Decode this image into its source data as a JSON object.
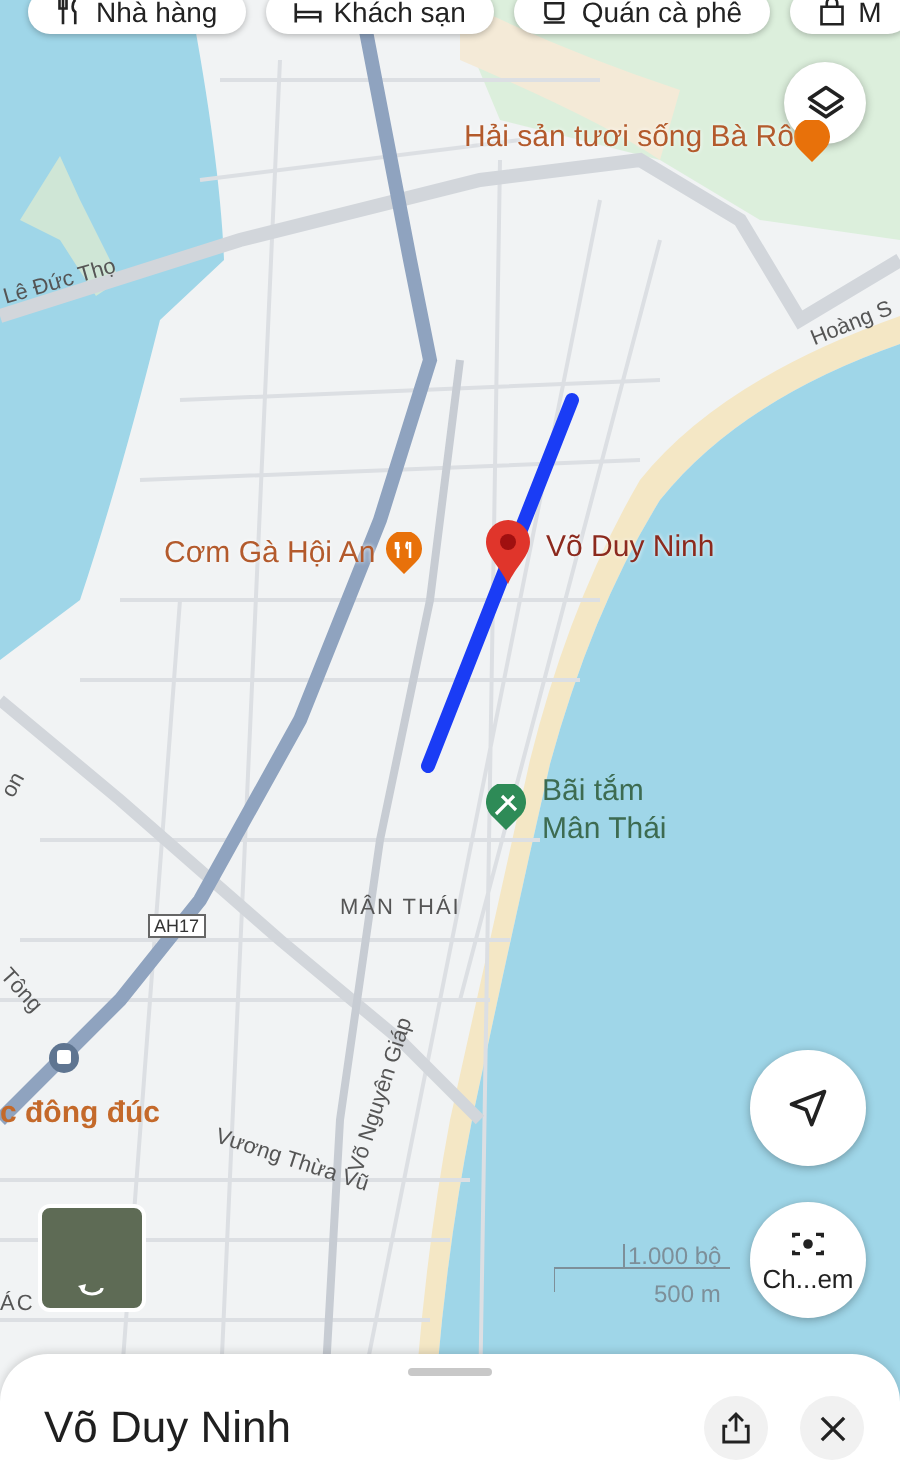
{
  "filter_chips": [
    {
      "label": "Nhà hàng",
      "kind": "restaurant"
    },
    {
      "label": "Khách sạn",
      "kind": "hotel"
    },
    {
      "label": "Quán cà phê",
      "kind": "cafe"
    },
    {
      "label": "M",
      "kind": "shopping"
    }
  ],
  "map_labels": [
    {
      "text": "Hải sản tươi sống Bà Rô",
      "kind": "food"
    },
    {
      "text": "Lê Đức Thọ",
      "kind": "street"
    },
    {
      "text": "Hoàng S",
      "kind": "street"
    },
    {
      "text": "Cơm Gà Hội An",
      "kind": "food"
    },
    {
      "text": "Võ Duy Ninh",
      "kind": "pin"
    },
    {
      "text": "Bãi tắm Mân Thái",
      "kind": "beach"
    },
    {
      "text": "on",
      "kind": "street"
    },
    {
      "text": "MÂN THÁI",
      "kind": "district"
    },
    {
      "text": "AH17",
      "kind": "shield"
    },
    {
      "text": "Tông",
      "kind": "street"
    },
    {
      "text": "c đông đúc",
      "kind": "busy"
    },
    {
      "text": "Vương Thừa Vũ",
      "kind": "street"
    },
    {
      "text": "Võ Nguyên Giáp",
      "kind": "street"
    },
    {
      "text": "ÁC",
      "kind": "district"
    }
  ],
  "scale": {
    "imperial": "1.000 bộ",
    "metric": "500 m"
  },
  "lens_button": {
    "label": "Ch...em"
  },
  "place_sheet": {
    "title": "Võ Duy Ninh"
  }
}
